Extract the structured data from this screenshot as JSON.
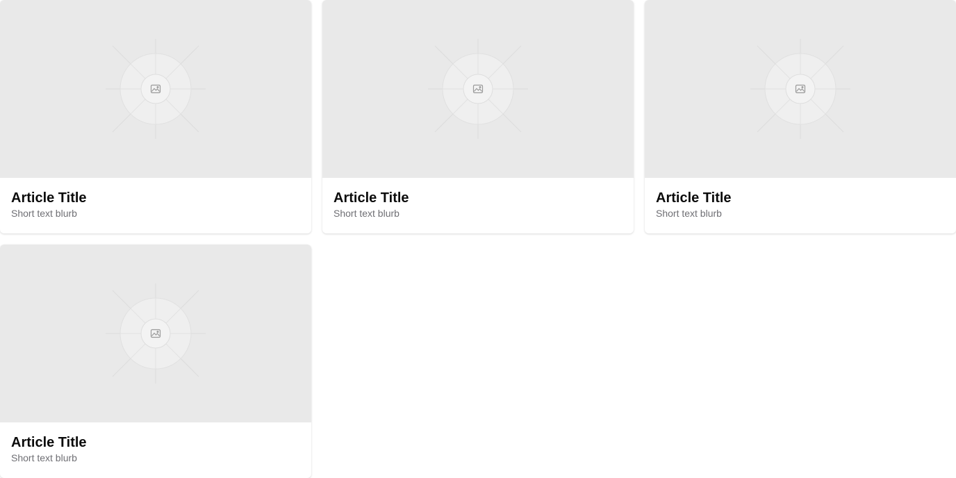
{
  "cards": [
    {
      "title": "Article Title",
      "blurb": "Short text blurb",
      "image_icon": "image-icon"
    },
    {
      "title": "Article Title",
      "blurb": "Short text blurb",
      "image_icon": "image-icon"
    },
    {
      "title": "Article Title",
      "blurb": "Short text blurb",
      "image_icon": "image-icon"
    },
    {
      "title": "Article Title",
      "blurb": "Short text blurb",
      "image_icon": "image-icon"
    }
  ],
  "colors": {
    "placeholder_bg": "#e9e9e9",
    "title": "#0b0b0b",
    "blurb": "#6f6f74"
  }
}
